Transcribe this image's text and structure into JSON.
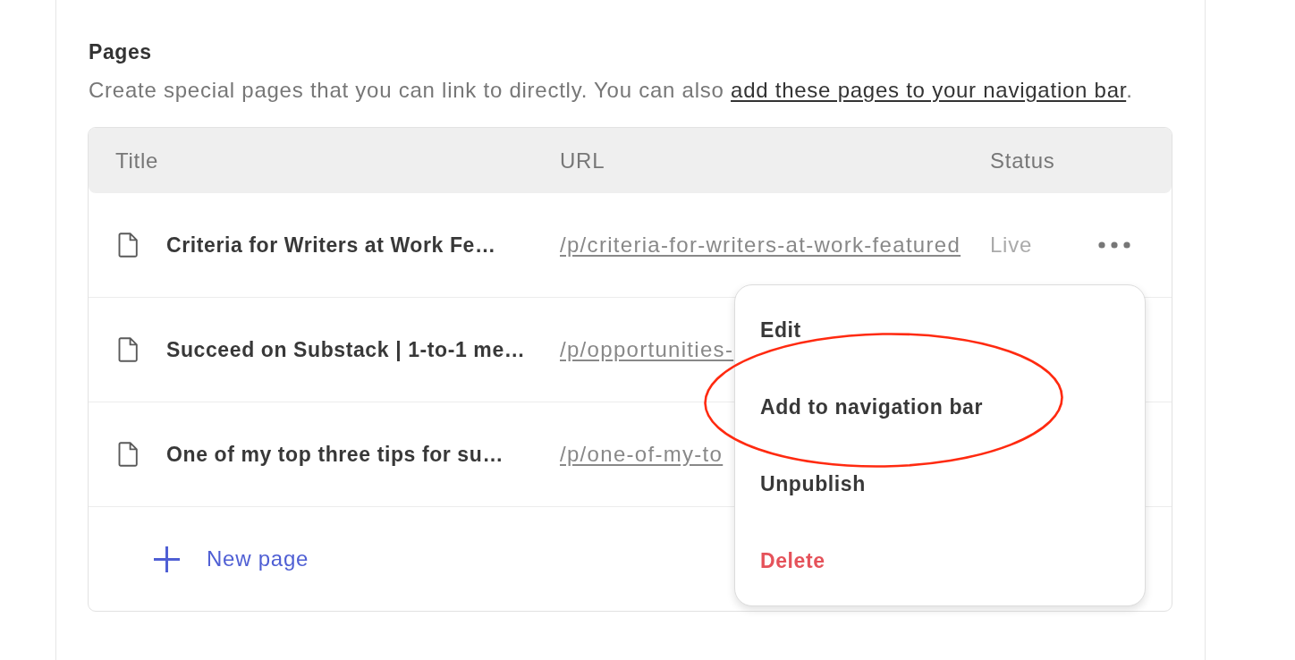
{
  "section": {
    "title": "Pages",
    "description": {
      "text": "Create special pages that you can link to directly. You can also ",
      "link": "add these pages to your navigation bar",
      "after": "."
    }
  },
  "table": {
    "columns": [
      "Title",
      "URL",
      "Status"
    ],
    "rows": [
      {
        "title": "Criteria for Writers at Work Fe…",
        "url": "/p/criteria-for-writers-at-work-featured",
        "status": "Live"
      },
      {
        "title": "Succeed on Substack | 1-to-1 me…",
        "url": "/p/opportunities-"
      },
      {
        "title": "One of my top three tips for su…",
        "url": "/p/one-of-my-to"
      }
    ],
    "new_page": {
      "label": "New page"
    }
  },
  "menu": {
    "items": [
      {
        "label": "Edit",
        "kind": "normal",
        "circled": false
      },
      {
        "label": "Add to navigation bar",
        "kind": "normal",
        "circled": true
      },
      {
        "label": "Unpublish",
        "kind": "normal",
        "circled": false
      },
      {
        "label": "Delete",
        "kind": "danger",
        "circled": false
      }
    ]
  }
}
